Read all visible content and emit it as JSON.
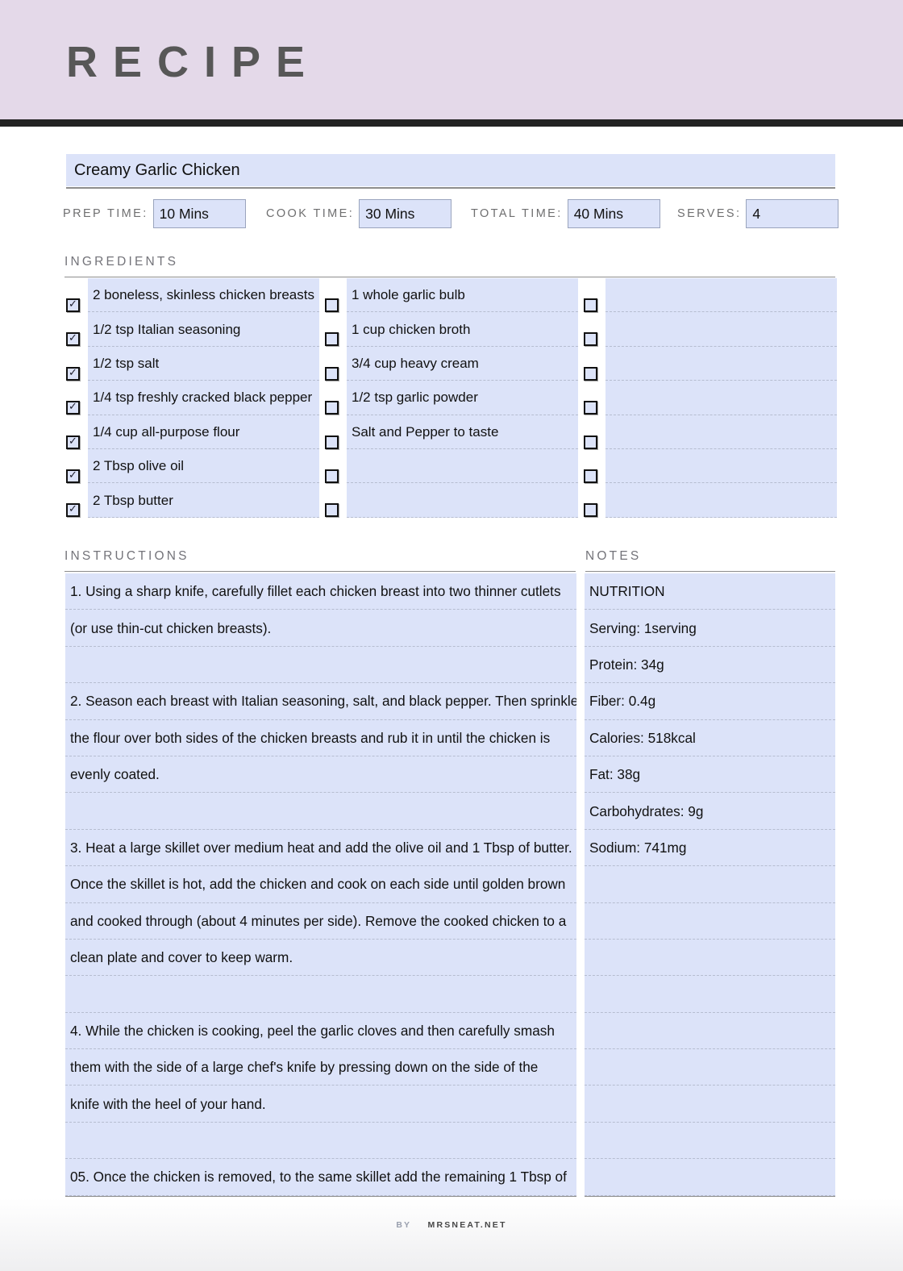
{
  "header": {
    "title": "RECIPE"
  },
  "recipe": {
    "name": "Creamy Garlic Chicken"
  },
  "meta": [
    {
      "label": "PREP TIME:",
      "value": "10 Mins"
    },
    {
      "label": "COOK TIME:",
      "value": "30 Mins"
    },
    {
      "label": "TOTAL TIME:",
      "value": "40 Mins"
    },
    {
      "label": "SERVES:",
      "value": "4"
    }
  ],
  "sections": {
    "ingredients_heading": "INGREDIENTS",
    "instructions_heading": "INSTRUCTIONS",
    "notes_heading": "NOTES"
  },
  "ingredients": {
    "columns": [
      {
        "items": [
          {
            "text": "2 boneless, skinless chicken breasts",
            "checked": true
          },
          {
            "text": "1/2 tsp Italian seasoning",
            "checked": true
          },
          {
            "text": "1/2 tsp salt",
            "checked": true
          },
          {
            "text": "1/4 tsp freshly cracked black pepper",
            "checked": true
          },
          {
            "text": "1/4 cup all-purpose flour",
            "checked": true
          },
          {
            "text": "2 Tbsp olive oil",
            "checked": true
          },
          {
            "text": "2 Tbsp butter",
            "checked": true
          }
        ]
      },
      {
        "items": [
          {
            "text": "1 whole garlic bulb",
            "checked": false
          },
          {
            "text": "1 cup chicken broth",
            "checked": false
          },
          {
            "text": "3/4 cup heavy cream",
            "checked": false
          },
          {
            "text": "1/2 tsp garlic powder",
            "checked": false
          },
          {
            "text": "Salt and Pepper to taste",
            "checked": false
          },
          {
            "text": "",
            "checked": false
          },
          {
            "text": "",
            "checked": false
          }
        ]
      },
      {
        "items": [
          {
            "text": "",
            "checked": false
          },
          {
            "text": "",
            "checked": false
          },
          {
            "text": "",
            "checked": false
          },
          {
            "text": "",
            "checked": false
          },
          {
            "text": "",
            "checked": false
          },
          {
            "text": "",
            "checked": false
          },
          {
            "text": "",
            "checked": false
          }
        ]
      }
    ],
    "check_glyph": "✓"
  },
  "instructions": {
    "lines": [
      "1. Using a sharp knife, carefully fillet each chicken breast into two thinner cutlets",
      "(or use thin-cut chicken breasts).",
      "",
      "2. Season each breast with Italian seasoning, salt, and black pepper. Then sprinkle",
      "the flour over both sides of the chicken breasts and rub it in until the chicken is",
      "evenly coated.",
      "",
      "3. Heat a large skillet over medium heat and add the olive oil and 1 Tbsp of butter.",
      "Once the skillet is hot, add the chicken and cook on each side until golden brown",
      "and cooked through (about 4 minutes per side). Remove the cooked chicken to a",
      "clean plate and cover to keep warm.",
      "",
      "4. While the chicken is cooking, peel the garlic cloves and then carefully smash",
      "them with the side of a large chef's knife by pressing down on the side of the",
      "knife with the heel of your hand.",
      "",
      "05. Once the chicken is removed, to the same skillet add the remaining 1 Tbsp of"
    ]
  },
  "notes": {
    "lines": [
      "NUTRITION",
      "Serving: 1serving",
      "Protein: 34g",
      "Fiber: 0.4g",
      "Calories: 518kcal",
      "Fat: 38g",
      "Carbohydrates: 9g",
      "Sodium: 741mg",
      "",
      "",
      "",
      "",
      "",
      "",
      "",
      "",
      ""
    ]
  },
  "footer": {
    "by_label": "BY",
    "brand": "MRSNEAT.NET"
  },
  "colors": {
    "header_band": "#e4d9e9",
    "header_rule": "#232323",
    "field_fill": "#dce3f9",
    "label_gray": "#6f6f70",
    "rule_gray": "#8d8d8d"
  }
}
